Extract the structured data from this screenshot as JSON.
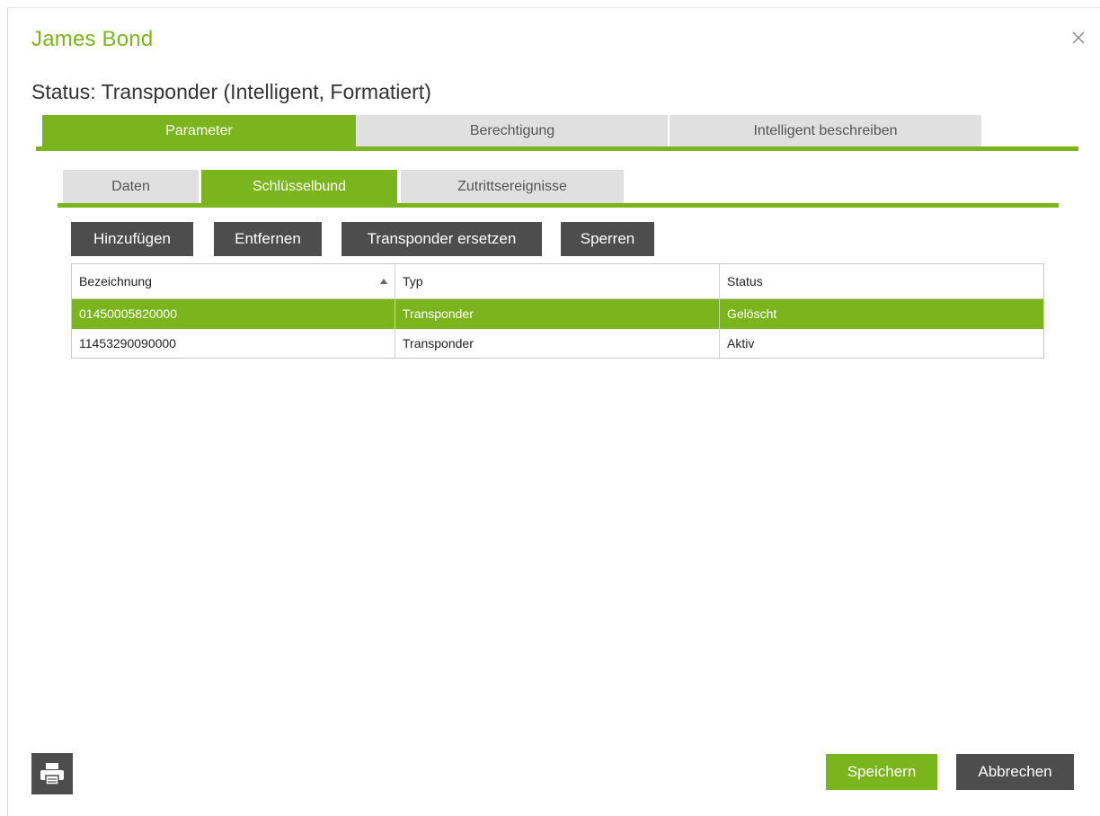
{
  "dialog": {
    "title": "James Bond",
    "status_line": "Status: Transponder (Intelligent, Formatiert)"
  },
  "main_tabs": [
    {
      "label": "Parameter",
      "active": true
    },
    {
      "label": "Berechtigung",
      "active": false
    },
    {
      "label": "Intelligent beschreiben",
      "active": false
    }
  ],
  "sub_tabs": [
    {
      "label": "Daten",
      "active": false
    },
    {
      "label": "Schlüsselbund",
      "active": true
    },
    {
      "label": "Zutrittsereignisse",
      "active": false
    }
  ],
  "toolbar": {
    "add_label": "Hinzufügen",
    "remove_label": "Entfernen",
    "replace_label": "Transponder ersetzen",
    "lock_label": "Sperren"
  },
  "grid": {
    "columns": [
      "Bezeichnung",
      "Typ",
      "Status"
    ],
    "sort_column": "Bezeichnung",
    "sort_direction": "ascending",
    "rows": [
      {
        "bezeichnung": "01450005820000",
        "typ": "Transponder",
        "status": "Gelöscht",
        "selected": true
      },
      {
        "bezeichnung": "11453290090000",
        "typ": "Transponder",
        "status": "Aktiv",
        "selected": false
      }
    ]
  },
  "footer": {
    "print_icon": "printer-icon",
    "save_label": "Speichern",
    "cancel_label": "Abbrechen"
  },
  "colors": {
    "accent": "#7ab51d",
    "button_dark": "#4d4d4d",
    "tab_inactive": "#e0e0e0"
  }
}
